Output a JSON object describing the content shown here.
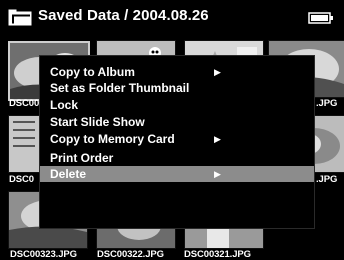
{
  "header": {
    "title": "Saved Data / 2004.08.26",
    "folder_icon": "folder-icon",
    "battery_icon": "battery-icon"
  },
  "thumbnails": [
    {
      "caption": "DSC00",
      "icon": "photo-thumbnail"
    },
    {
      "caption": "",
      "icon": "photo-thumbnail"
    },
    {
      "caption": "",
      "icon": "photo-thumbnail"
    },
    {
      "caption": ".JPG",
      "icon": "photo-thumbnail"
    },
    {
      "caption": "DSC0",
      "icon": "photo-thumbnail"
    },
    {
      "caption": "",
      "icon": "photo-thumbnail"
    },
    {
      "caption": "",
      "icon": "photo-thumbnail"
    },
    {
      "caption": ".JPG",
      "icon": "photo-thumbnail"
    },
    {
      "caption": "DSC00323.JPG",
      "icon": "photo-thumbnail"
    },
    {
      "caption": "DSC00322.JPG",
      "icon": "photo-thumbnail"
    },
    {
      "caption": "DSC00321.JPG",
      "icon": "photo-thumbnail"
    }
  ],
  "menu": {
    "items": [
      {
        "label": "Copy to Album",
        "has_submenu": true
      },
      {
        "label": "Set as Folder Thumbnail",
        "has_submenu": false
      },
      {
        "label": "Lock",
        "has_submenu": false
      },
      {
        "label": "Start Slide Show",
        "has_submenu": false
      },
      {
        "label": "Copy to Memory Card",
        "has_submenu": true
      },
      {
        "label": "Print Order",
        "has_submenu": false
      },
      {
        "label": "Delete",
        "has_submenu": true,
        "highlighted": true
      }
    ],
    "submenu_arrow": "▶",
    "highlight_color": "#8c8c8c"
  }
}
